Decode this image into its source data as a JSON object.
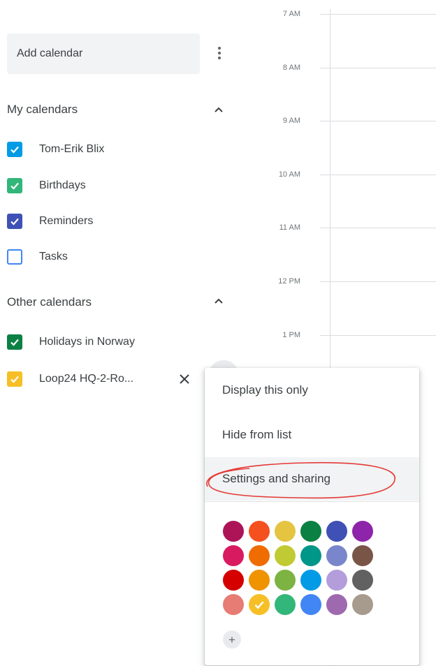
{
  "time_grid": {
    "hours": [
      "7 AM",
      "8 AM",
      "9 AM",
      "10 AM",
      "11 AM",
      "12 PM",
      "1 PM"
    ]
  },
  "sidebar": {
    "add_calendar_placeholder": "Add calendar",
    "more_icon": "more-vert-icon",
    "my_calendars": {
      "title": "My calendars",
      "collapse_icon": "chevron-up-icon",
      "items": [
        {
          "label": "Tom-Erik Blix",
          "checked": true,
          "color": "#039be5"
        },
        {
          "label": "Birthdays",
          "checked": true,
          "color": "#33b679"
        },
        {
          "label": "Reminders",
          "checked": true,
          "color": "#3f51b5"
        },
        {
          "label": "Tasks",
          "checked": false,
          "color": "#4285f4"
        }
      ]
    },
    "other_calendars": {
      "title": "Other calendars",
      "collapse_icon": "chevron-up-icon",
      "items": [
        {
          "label": "Holidays in Norway",
          "checked": true,
          "color": "#0b8043"
        },
        {
          "label": "Loop24 HQ-2-Ro...",
          "checked": true,
          "color": "#f6bf26",
          "remove_icon": "close-icon"
        }
      ]
    }
  },
  "context_menu": {
    "items": [
      {
        "label": "Display this only"
      },
      {
        "label": "Hide from list"
      },
      {
        "label": "Settings and sharing",
        "highlighted": true
      }
    ],
    "annotation_color": "#e53935",
    "colors": [
      [
        "#ad1457",
        "#f4511e",
        "#e4c441",
        "#0b8043",
        "#3f51b5",
        "#8e24aa"
      ],
      [
        "#d81b60",
        "#ef6c00",
        "#c0ca33",
        "#009688",
        "#7986cb",
        "#795548"
      ],
      [
        "#d50000",
        "#f09300",
        "#7cb342",
        "#039be5",
        "#b39ddb",
        "#616161"
      ],
      [
        "#e67c73",
        "#f6bf26",
        "#33b679",
        "#4285f4",
        "#9e69af",
        "#a79b8e"
      ]
    ],
    "selected_color": "#f6bf26",
    "add_color_label": "+"
  }
}
